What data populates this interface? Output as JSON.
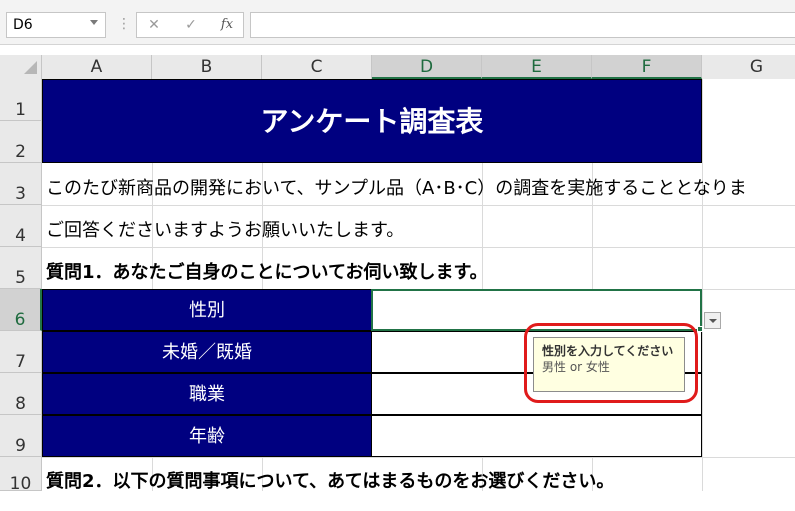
{
  "formula_bar": {
    "name_box": "D6",
    "separator": "⋮",
    "cancel_icon": "✕",
    "enter_icon": "✓",
    "fx_icon": "fx",
    "formula": ""
  },
  "columns": [
    "A",
    "B",
    "C",
    "D",
    "E",
    "F",
    "G"
  ],
  "rows": [
    "1",
    "2",
    "3",
    "4",
    "5",
    "6",
    "7",
    "8",
    "9",
    "10"
  ],
  "sheet": {
    "title": "アンケート調査表",
    "intro_line1": "このたび新商品の開発において、サンプル品（A･B･C）の調査を実施することとなりま",
    "intro_line2": "ご回答くださいますようお願いいたします。",
    "question1": "質問1．あなたご自身のことについてお伺い致します。",
    "question2": "質問2．以下の質問事項について、あてはまるものをお選びください。",
    "fields": [
      {
        "label": "性別",
        "value": ""
      },
      {
        "label": "未婚／既婚",
        "value": ""
      },
      {
        "label": "職業",
        "value": ""
      },
      {
        "label": "年齢",
        "value": ""
      }
    ]
  },
  "tooltip": {
    "title": "性別を入力してください",
    "message": "男性 or 女性"
  },
  "colors": {
    "header_fill": "#000080",
    "selection": "#217346",
    "highlight": "#e01b1b"
  }
}
